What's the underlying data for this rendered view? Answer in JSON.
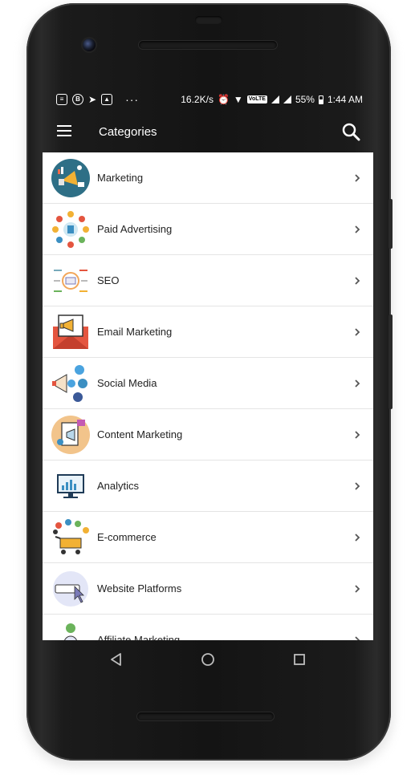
{
  "status_bar": {
    "left_icons": [
      "news-icon",
      "b-icon",
      "location-arrow-icon",
      "photo-icon"
    ],
    "more_indicator": "···",
    "net_speed": "16.2K/s",
    "volte": "VoLTE",
    "battery": "55%",
    "time": "1:44 AM"
  },
  "app_bar": {
    "title": "Categories",
    "menu_icon": "hamburger-menu-icon",
    "search_icon": "search-icon"
  },
  "categories": [
    {
      "label": "Marketing",
      "icon": "megaphone-icon"
    },
    {
      "label": "Paid Advertising",
      "icon": "paid-ads-network-icon"
    },
    {
      "label": "SEO",
      "icon": "seo-icon"
    },
    {
      "label": "Email Marketing",
      "icon": "envelope-megaphone-icon"
    },
    {
      "label": "Social Media",
      "icon": "social-megaphone-icon"
    },
    {
      "label": "Content Marketing",
      "icon": "content-document-icon"
    },
    {
      "label": "Analytics",
      "icon": "analytics-monitor-icon"
    },
    {
      "label": "E-commerce",
      "icon": "shopping-cart-icon"
    },
    {
      "label": "Website Platforms",
      "icon": "website-cursor-icon"
    },
    {
      "label": "Affiliate Marketing",
      "icon": "affiliate-network-icon"
    }
  ],
  "nav_bar": [
    "back-icon",
    "home-icon",
    "recents-icon"
  ],
  "colors": {
    "phone_body": "#141414",
    "app_bar": "#000000",
    "list_bg": "#ffffff",
    "divider": "#e4e4e4",
    "chevron": "#555555"
  }
}
